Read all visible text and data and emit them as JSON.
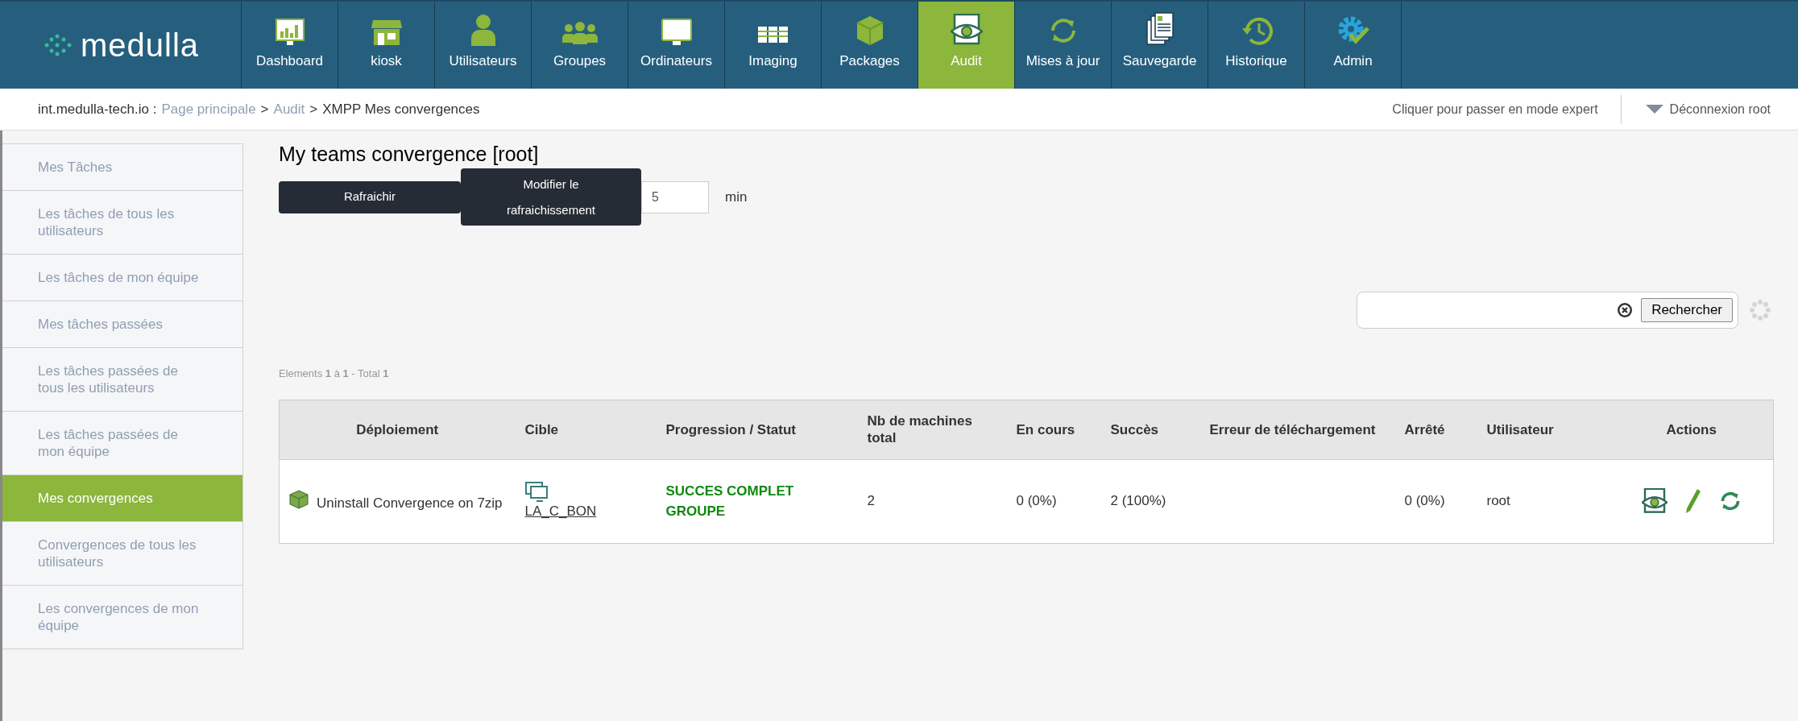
{
  "logo": {
    "text": "medulla"
  },
  "nav": [
    {
      "label": "Dashboard",
      "kind": "dashboard",
      "selected": false
    },
    {
      "label": "kiosk",
      "kind": "kiosk",
      "selected": false
    },
    {
      "label": "Utilisateurs",
      "kind": "user",
      "selected": false
    },
    {
      "label": "Groupes",
      "kind": "group",
      "selected": false
    },
    {
      "label": "Ordinateurs",
      "kind": "monitor",
      "selected": false
    },
    {
      "label": "Imaging",
      "kind": "imaging",
      "selected": false
    },
    {
      "label": "Packages",
      "kind": "package",
      "selected": false
    },
    {
      "label": "Audit",
      "kind": "audit",
      "selected": true
    },
    {
      "label": "Mises à jour",
      "kind": "refresh",
      "selected": false
    },
    {
      "label": "Sauvegarde",
      "kind": "docs",
      "selected": false
    },
    {
      "label": "Historique",
      "kind": "history",
      "selected": false
    },
    {
      "label": "Admin",
      "kind": "gear",
      "selected": false
    }
  ],
  "breadcrumb": {
    "host": "int.medulla-tech.io :",
    "links": [
      {
        "label": "Page principale",
        "separator": ">"
      },
      {
        "label": "Audit",
        "separator": ">"
      }
    ],
    "current": "XMPP Mes convergences"
  },
  "expert_mode": "Cliquer pour passer en mode expert",
  "logout": "Déconnexion root",
  "sidebar": {
    "items": [
      {
        "label": "Mes Tâches",
        "selected": false
      },
      {
        "label": "Les tâches de tous les utilisateurs",
        "selected": false
      },
      {
        "label": "Les tâches de mon équipe",
        "selected": false
      },
      {
        "label": "Mes tâches passées",
        "selected": false
      },
      {
        "label": "Les tâches passées de tous les utilisateurs",
        "selected": false
      },
      {
        "label": "Les tâches passées de mon équipe",
        "selected": false
      },
      {
        "label": "Mes convergences",
        "selected": true
      },
      {
        "label": "Convergences de tous les utilisateurs",
        "selected": false
      },
      {
        "label": "Les convergences de mon équipe",
        "selected": false
      }
    ]
  },
  "title": "My teams convergence [root]",
  "refresh_button": "Rafraichir",
  "modify_button": "Modifier le rafraichissement",
  "interval": {
    "value": "5",
    "unit": "min"
  },
  "search": {
    "button": "Rechercher"
  },
  "pagination": "Elements **1** à **1** - Total **1**",
  "table": {
    "columns": [
      "Déploiement",
      "Cible",
      "Progression / Statut",
      "Nb de machines total",
      "En cours",
      "Succès",
      "Erreur de téléchargement",
      "Arrêté",
      "Utilisateur",
      "Actions"
    ],
    "rows": [
      {
        "deployment": "Uninstall Convergence on 7zip",
        "target": "LA_C_BON",
        "status": "SUCCES COMPLET GROUPE",
        "total": "2",
        "in_progress": "0 (0%)",
        "success": "2 (100%)",
        "download_error": "",
        "stopped": "0 (0%)",
        "user": "root",
        "actions": [
          {
            "kind": "audit"
          },
          {
            "kind": "edit"
          },
          {
            "kind": "refresh"
          }
        ]
      }
    ]
  }
}
